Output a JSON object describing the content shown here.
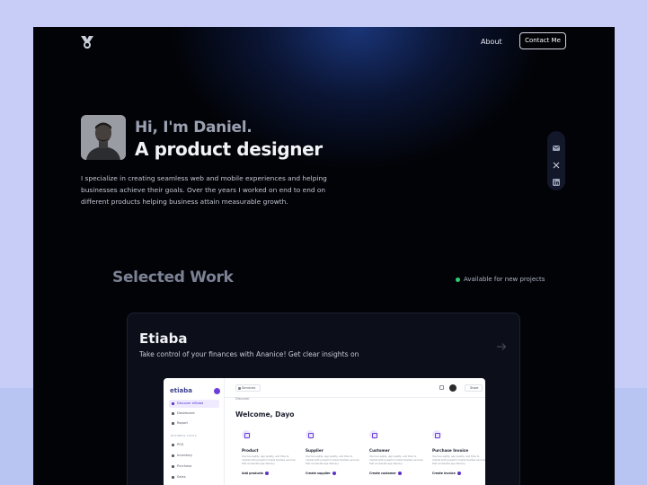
{
  "nav": {
    "about_label": "About",
    "contact_label": "Contact Me"
  },
  "hero": {
    "greeting": "Hi, I'm Daniel.",
    "headline": "A product designer",
    "bio": "I specialize in creating seamless web and mobile experiences and helping businesses achieve their goals. Over the years I worked on end to end on different products helping business attain measurable growth."
  },
  "social": {
    "icons": [
      "mail-icon",
      "x-icon",
      "linkedin-icon"
    ]
  },
  "work": {
    "title": "Selected Work",
    "availability": "Available for new projects"
  },
  "project": {
    "title": "Etiaba",
    "description": "Take control of your finances with Ananice! Get clear insights on",
    "preview": {
      "logo": "etiaba",
      "sidebar_items": [
        "Discover eStaba",
        "Dashboard",
        "Report"
      ],
      "section_label": "BUSINESS TOOLS",
      "section_items": [
        "POS",
        "Inventory",
        "Purchase",
        "Sales"
      ],
      "branch_select": "Services",
      "store_select": "Store",
      "crumb": "Discover",
      "welcome": "Welcome, Dayo",
      "tiles": [
        {
          "title": "Product",
          "desc": "Improve agility, app quality, and time to market with powerful mobile DevOps services that accelerate app delivery.",
          "link": "Add products"
        },
        {
          "title": "Supplier",
          "desc": "Improve agility, app quality, and time to market with powerful mobile DevOps services that accelerate app delivery.",
          "link": "Create supplier"
        },
        {
          "title": "Customer",
          "desc": "Improve agility, app quality, and time to market with powerful mobile DevOps services that accelerate app delivery.",
          "link": "Create customer"
        },
        {
          "title": "Purchase Invoice",
          "desc": "Improve agility, app quality, and time to market with powerful mobile DevOps services that accelerate app delivery.",
          "link": "Create invoice"
        }
      ]
    }
  },
  "colors": {
    "page_bg": "#020307",
    "accent_glow": "#1e3e8c",
    "available_dot": "#2ecc71",
    "preview_accent": "#6b3fd8"
  }
}
